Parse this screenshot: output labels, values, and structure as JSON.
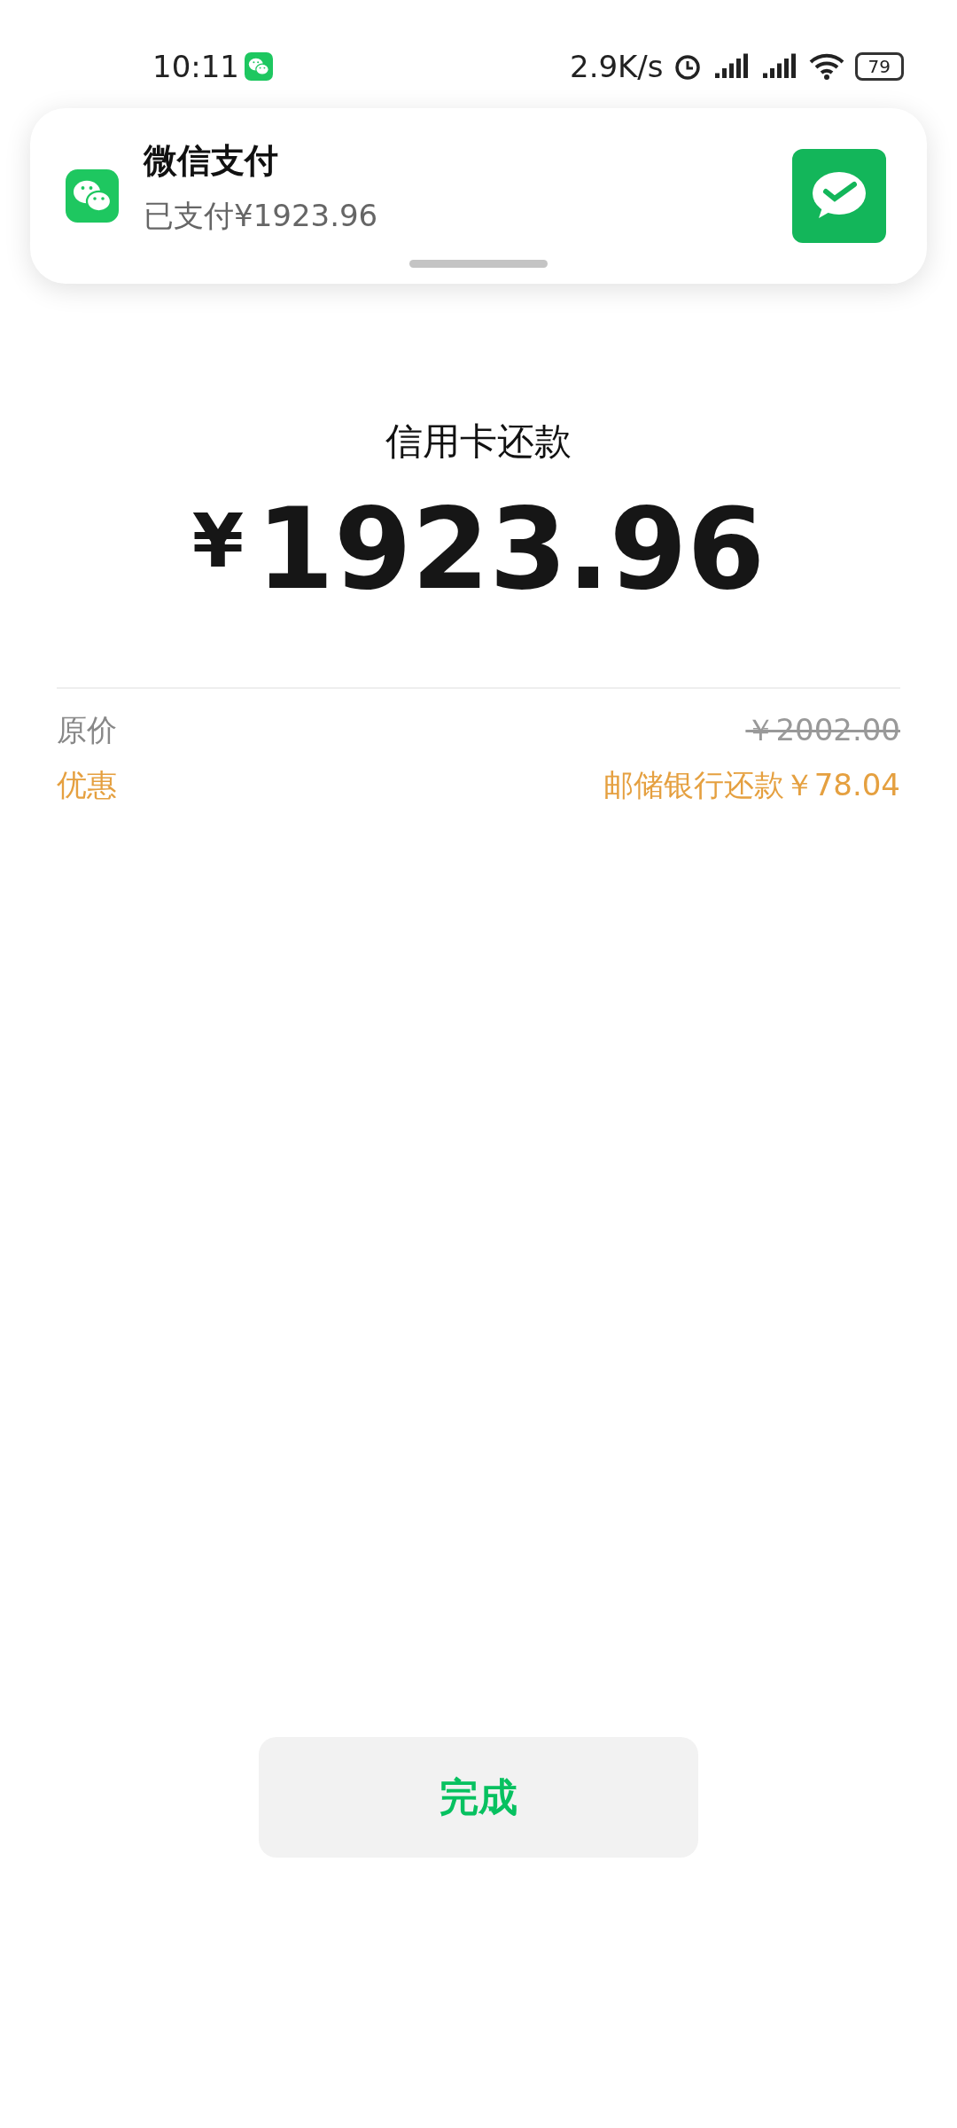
{
  "status_bar": {
    "time": "10:11",
    "speed": "2.9K/s",
    "battery": "79"
  },
  "notification": {
    "app": "微信支付",
    "message": "已支付¥1923.96"
  },
  "payment": {
    "title": "信用卡还款",
    "currency": "¥",
    "amount": "1923.96"
  },
  "price_rows": [
    {
      "kind": "original",
      "label": "原价",
      "value": "￥2002.00"
    },
    {
      "kind": "discount",
      "label": "优惠",
      "value": "邮储银行还款￥78.04"
    }
  ],
  "done_button": {
    "label": "完成"
  }
}
